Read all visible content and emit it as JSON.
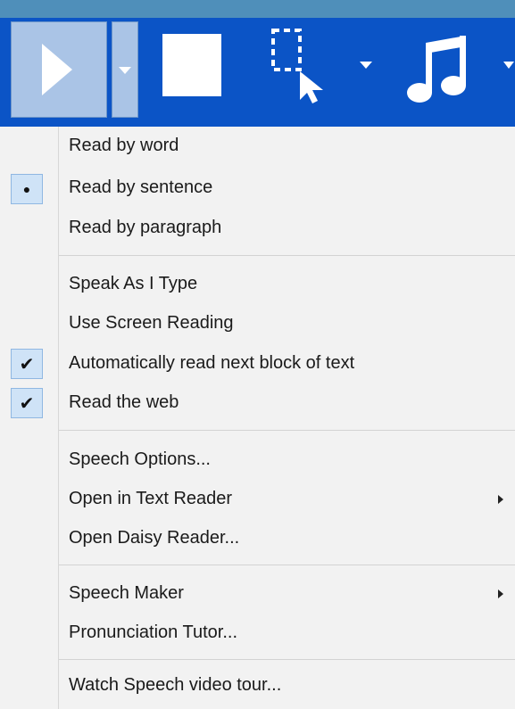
{
  "toolbar": {
    "buttons": [
      {
        "name": "play-button",
        "icon": "play-icon"
      },
      {
        "name": "play-options-dropdown",
        "icon": "chevron-down-icon"
      },
      {
        "name": "stop-button",
        "icon": "stop-icon"
      },
      {
        "name": "select-to-read-button",
        "icon": "select-pointer-icon"
      },
      {
        "name": "select-options-dropdown",
        "icon": "chevron-down-icon"
      },
      {
        "name": "voice-button",
        "icon": "music-note-icon"
      },
      {
        "name": "voice-options-dropdown",
        "icon": "chevron-down-icon"
      }
    ],
    "colors": {
      "background": "#0b54c6",
      "active": "#aac4e6",
      "icon": "#ffffff"
    }
  },
  "menu": {
    "group1": [
      {
        "label": "Read by word",
        "state": "none"
      },
      {
        "label": "Read by sentence",
        "state": "radio"
      },
      {
        "label": "Read by paragraph",
        "state": "none"
      }
    ],
    "group2": [
      {
        "label": "Speak As I Type",
        "state": "none"
      },
      {
        "label": "Use Screen Reading",
        "state": "none"
      },
      {
        "label": "Automatically read next block of text",
        "state": "checked"
      },
      {
        "label": "Read the web",
        "state": "checked"
      }
    ],
    "group3": [
      {
        "label": "Speech Options...",
        "submenu": false
      },
      {
        "label": "Open in Text Reader",
        "submenu": true
      },
      {
        "label": "Open Daisy Reader...",
        "submenu": false
      }
    ],
    "group4": [
      {
        "label": "Speech Maker",
        "submenu": true
      },
      {
        "label": "Pronunciation Tutor...",
        "submenu": false
      }
    ],
    "group5": [
      {
        "label": "Watch Speech video tour...",
        "submenu": false
      }
    ],
    "glyphs": {
      "radio": "●",
      "check": "✔"
    }
  }
}
